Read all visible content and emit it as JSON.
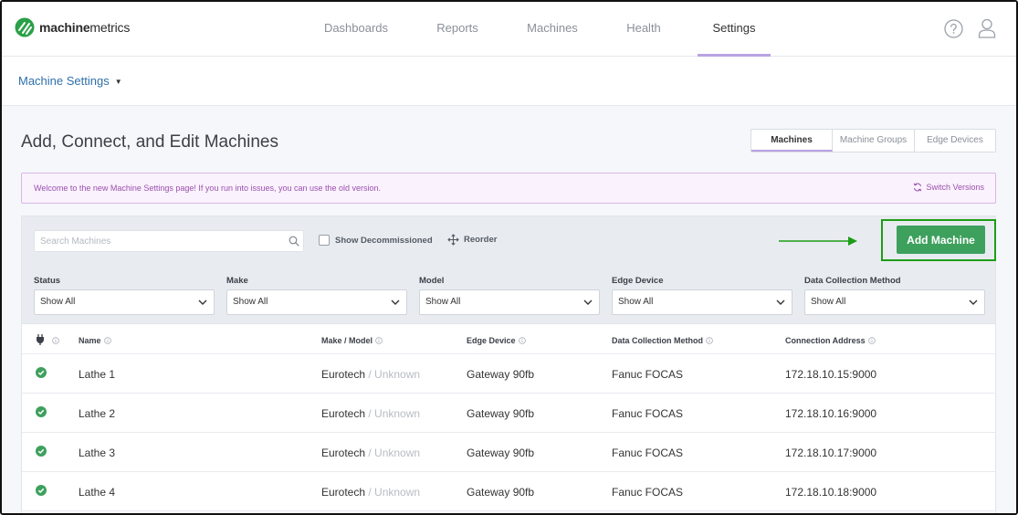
{
  "brand": {
    "name_bold": "machine",
    "name_regular": "metrics",
    "logo_color": "#2aa048"
  },
  "nav": {
    "items": [
      {
        "label": "Dashboards",
        "active": false
      },
      {
        "label": "Reports",
        "active": false
      },
      {
        "label": "Machines",
        "active": false
      },
      {
        "label": "Health",
        "active": false
      },
      {
        "label": "Settings",
        "active": true
      }
    ],
    "icons": [
      "help-icon",
      "user-icon"
    ]
  },
  "breadcrumb": {
    "label": "Machine Settings"
  },
  "page": {
    "title": "Add, Connect, and Edit Machines",
    "tabs": [
      {
        "label": "Machines",
        "active": true
      },
      {
        "label": "Machine Groups",
        "active": false
      },
      {
        "label": "Edge Devices",
        "active": false
      }
    ]
  },
  "banner": {
    "message": "Welcome to the new Machine Settings page! If you run into issues, you can use the old version.",
    "switch_label": "Switch Versions"
  },
  "toolbar": {
    "search_placeholder": "Search Machines",
    "show_decommissioned_label": "Show Decommissioned",
    "show_decommissioned_checked": false,
    "reorder_label": "Reorder",
    "add_button_label": "Add Machine",
    "accent_green": "#3ea05d"
  },
  "filters": [
    {
      "label": "Status",
      "value": "Show All"
    },
    {
      "label": "Make",
      "value": "Show All"
    },
    {
      "label": "Model",
      "value": "Show All"
    },
    {
      "label": "Edge Device",
      "value": "Show All"
    },
    {
      "label": "Data Collection Method",
      "value": "Show All"
    }
  ],
  "table": {
    "columns": [
      "Name",
      "Make / Model",
      "Edge Device",
      "Data Collection Method",
      "Connection Address"
    ],
    "rows": [
      {
        "status": "connected",
        "name": "Lathe 1",
        "make": "Eurotech",
        "model": "/ Unknown",
        "edge": "Gateway 90fb",
        "method": "Fanuc FOCAS",
        "address": "172.18.10.15:9000"
      },
      {
        "status": "connected",
        "name": "Lathe 2",
        "make": "Eurotech",
        "model": "/ Unknown",
        "edge": "Gateway 90fb",
        "method": "Fanuc FOCAS",
        "address": "172.18.10.16:9000"
      },
      {
        "status": "connected",
        "name": "Lathe 3",
        "make": "Eurotech",
        "model": "/ Unknown",
        "edge": "Gateway 90fb",
        "method": "Fanuc FOCAS",
        "address": "172.18.10.17:9000"
      },
      {
        "status": "connected",
        "name": "Lathe 4",
        "make": "Eurotech",
        "model": "/ Unknown",
        "edge": "Gateway 90fb",
        "method": "Fanuc FOCAS",
        "address": "172.18.10.18:9000"
      }
    ]
  }
}
